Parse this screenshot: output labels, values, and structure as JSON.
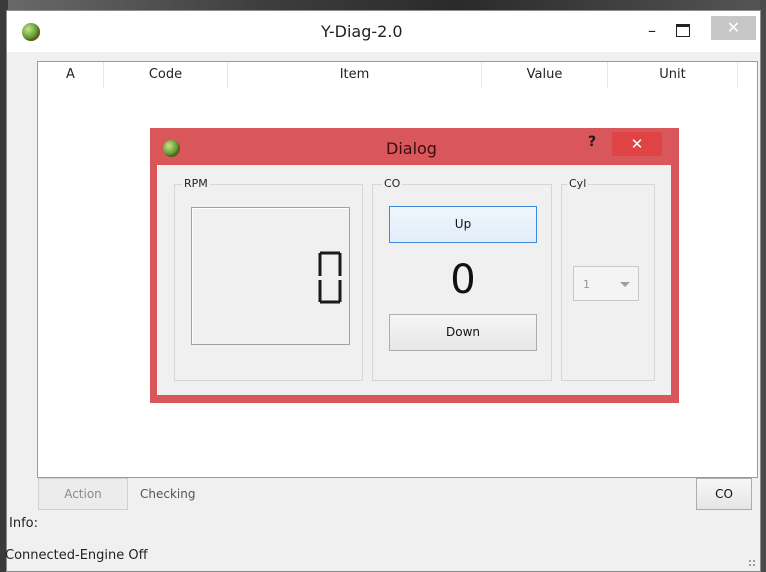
{
  "window": {
    "title": "Y-Diag-2.0",
    "minimize_glyph": "–",
    "close_glyph": "✕"
  },
  "table": {
    "columns": [
      "A",
      "Code",
      "Item",
      "Value",
      "Unit"
    ],
    "rows": []
  },
  "dialog": {
    "title": "Dialog",
    "help_glyph": "?",
    "close_glyph": "✕",
    "rpm": {
      "label": "RPM",
      "value": "0"
    },
    "co": {
      "label": "CO",
      "up_label": "Up",
      "down_label": "Down",
      "value": "0"
    },
    "cyl": {
      "label": "Cyl",
      "selected": "1"
    }
  },
  "footer": {
    "action_label": "Action",
    "checking_text": "Checking",
    "co_button_label": "CO",
    "info_label": "Info:",
    "status_text": "Connected-Engine Off"
  },
  "colors": {
    "dialog_frame": "#d9575a",
    "dialog_close": "#e04343",
    "focus_border": "#3c8ad8"
  },
  "icons": [
    "app-icon",
    "dialog-app-icon",
    "dropdown-arrow-icon",
    "resize-grip-icon"
  ]
}
